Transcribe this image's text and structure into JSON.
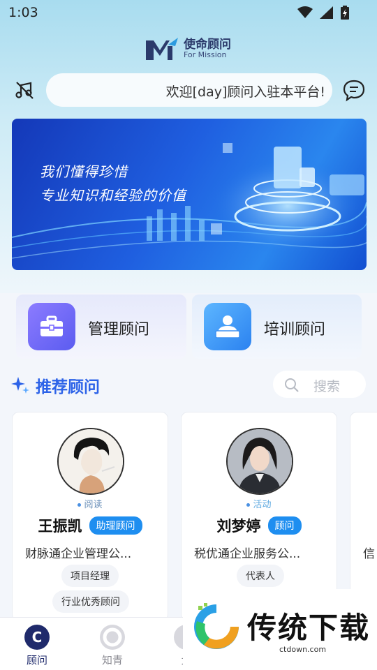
{
  "status_bar": {
    "time": "1:03"
  },
  "brand": {
    "name": "使命顾问",
    "subtitle": "For Mission"
  },
  "welcome": {
    "marquee": "欢迎[day]顾问入驻本平台!"
  },
  "banner": {
    "line1": "我们懂得珍惜",
    "line2": "专业知识和经验的价值"
  },
  "features": [
    {
      "label": "管理顾问",
      "icon": "toolbox-icon"
    },
    {
      "label": "培训顾问",
      "icon": "teacher-icon"
    }
  ],
  "section": {
    "title": "推荐顾问",
    "search_placeholder": "搜索"
  },
  "advisors": [
    {
      "status": "阅读",
      "name": "王振凯",
      "role": "助理顾问",
      "company": "财脉通企业管理公...",
      "tags": [
        "项目经理",
        "行业优秀顾问"
      ]
    },
    {
      "status": "活动",
      "name": "刘梦婷",
      "role": "顾问",
      "company": "税优通企业服务公...",
      "tags": [
        "代表人"
      ]
    },
    {
      "company": "信"
    }
  ],
  "tabs": [
    {
      "label": "顾问",
      "icon": "C"
    },
    {
      "label": "知青",
      "icon": ""
    },
    {
      "label": "大",
      "icon": ""
    }
  ],
  "watermark": {
    "text": "传统下载",
    "url": "ctdown.com"
  },
  "colors": {
    "accent": "#2d63e8",
    "badge": "#1e8ef0",
    "nav_active": "#1f2a6b"
  }
}
